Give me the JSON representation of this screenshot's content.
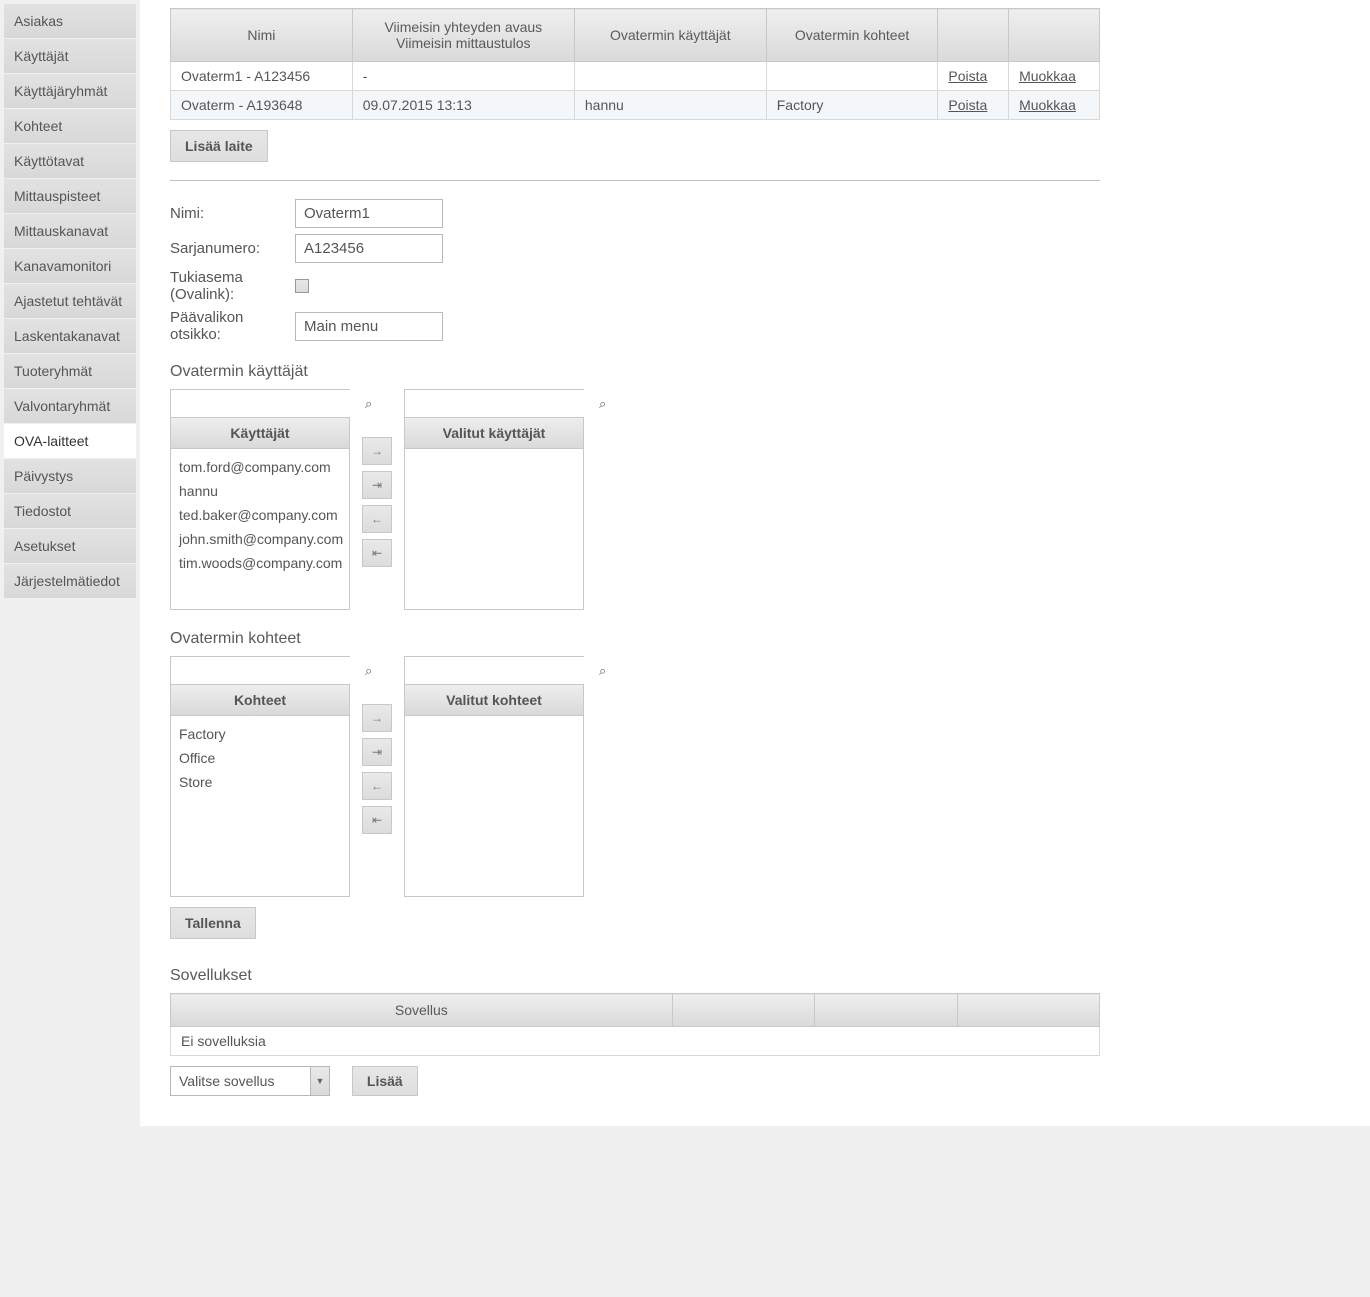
{
  "sidebar": {
    "items": [
      {
        "label": "Asiakas",
        "active": false
      },
      {
        "label": "Käyttäjät",
        "active": false
      },
      {
        "label": "Käyttäjäryhmät",
        "active": false
      },
      {
        "label": "Kohteet",
        "active": false
      },
      {
        "label": "Käyttötavat",
        "active": false
      },
      {
        "label": "Mittauspisteet",
        "active": false
      },
      {
        "label": "Mittauskanavat",
        "active": false
      },
      {
        "label": "Kanavamonitori",
        "active": false
      },
      {
        "label": "Ajastetut tehtävät",
        "active": false
      },
      {
        "label": "Laskentakanavat",
        "active": false
      },
      {
        "label": "Tuoteryhmät",
        "active": false
      },
      {
        "label": "Valvontaryhmät",
        "active": false
      },
      {
        "label": "OVA-laitteet",
        "active": true
      },
      {
        "label": "Päivystys",
        "active": false
      },
      {
        "label": "Tiedostot",
        "active": false
      },
      {
        "label": "Asetukset",
        "active": false
      },
      {
        "label": "Järjestelmätiedot",
        "active": false
      }
    ]
  },
  "device_table": {
    "headers": {
      "name": "Nimi",
      "last_line1": "Viimeisin yhteyden avaus",
      "last_line2": "Viimeisin mittaustulos",
      "users": "Ovatermin käyttäjät",
      "targets": "Ovatermin kohteet"
    },
    "rows": [
      {
        "name": "Ovaterm1 - A123456",
        "last": "-",
        "users": "",
        "targets": "",
        "delete": "Poista",
        "edit": "Muokkaa"
      },
      {
        "name": "Ovaterm - A193648",
        "last": "09.07.2015 13:13",
        "users": "hannu",
        "targets": "Factory",
        "delete": "Poista",
        "edit": "Muokkaa"
      }
    ],
    "add_button": "Lisää laite"
  },
  "form": {
    "name_label": "Nimi:",
    "name_value": "Ovaterm1",
    "serial_label": "Sarjanumero:",
    "serial_value": "A123456",
    "base_label": "Tukiasema (Ovalink):",
    "menu_label": "Päävalikon otsikko:",
    "menu_value": "Main menu"
  },
  "users_section": {
    "title": "Ovatermin käyttäjät",
    "available_header": "Käyttäjät",
    "selected_header": "Valitut käyttäjät",
    "available": [
      "tom.ford@company.com",
      "hannu",
      "ted.baker@company.com",
      "john.smith@company.com",
      "tim.woods@company.com"
    ]
  },
  "targets_section": {
    "title": "Ovatermin kohteet",
    "available_header": "Kohteet",
    "selected_header": "Valitut kohteet",
    "available": [
      "Factory",
      "Office",
      "Store"
    ]
  },
  "save_button": "Tallenna",
  "apps_section": {
    "title": "Sovellukset",
    "header": "Sovellus",
    "empty": "Ei sovelluksia",
    "select_placeholder": "Valitse sovellus",
    "add_button": "Lisää"
  },
  "arrows": {
    "right": "→",
    "right_all": "⇥",
    "left": "←",
    "left_all": "⇤"
  }
}
